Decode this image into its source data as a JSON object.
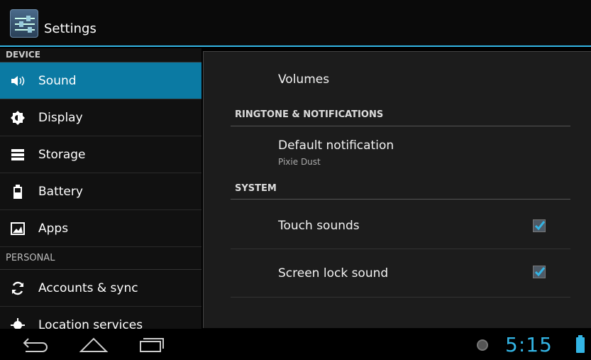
{
  "action_bar": {
    "title": "Settings",
    "icon": "settings-sliders-icon"
  },
  "sidebar": {
    "sections": [
      {
        "label": "DEVICE"
      },
      {
        "label": "PERSONAL"
      }
    ],
    "items": [
      {
        "label": "Sound",
        "icon": "speaker-icon",
        "active": true
      },
      {
        "label": "Display",
        "icon": "brightness-icon"
      },
      {
        "label": "Storage",
        "icon": "storage-icon"
      },
      {
        "label": "Battery",
        "icon": "battery-icon"
      },
      {
        "label": "Apps",
        "icon": "apps-icon"
      },
      {
        "label": "Accounts & sync",
        "icon": "sync-icon"
      },
      {
        "label": "Location services",
        "icon": "location-icon"
      }
    ]
  },
  "panel": {
    "volumes": "Volumes",
    "ringtone_header": "RINGTONE & NOTIFICATIONS",
    "default_notification": {
      "title": "Default notification",
      "summary": "Pixie Dust"
    },
    "system_header": "SYSTEM",
    "touch_sounds": {
      "title": "Touch sounds",
      "checked": true
    },
    "screen_lock_sound": {
      "title": "Screen lock sound",
      "checked": true
    }
  },
  "status": {
    "clock": "5:15",
    "accent": "#33b5e5"
  }
}
